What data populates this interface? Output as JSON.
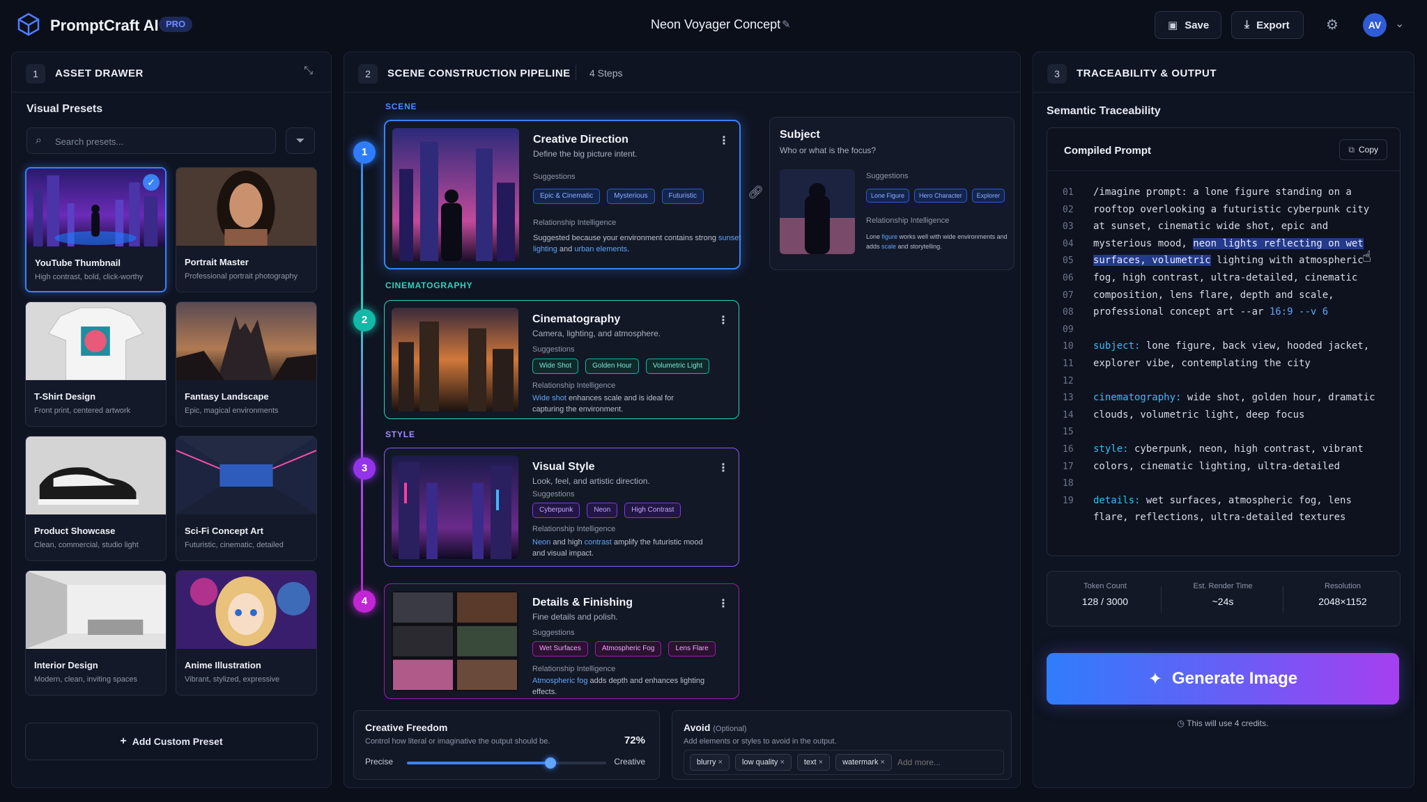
{
  "app": {
    "title": "PromptCraft AI",
    "badge": "PRO",
    "project_title": "Neon Voyager Concept"
  },
  "toolbar": {
    "save_label": "Save",
    "export_label": "Export",
    "avatar_initials": "AV"
  },
  "left": {
    "panel_num": "1",
    "panel_title": "ASSET DRAWER",
    "section_title": "Visual Presets",
    "search_placeholder": "Search presets...",
    "presets": [
      {
        "name": "YouTube Thumbnail",
        "desc": "High contrast, bold, click-worthy",
        "selected": true
      },
      {
        "name": "Portrait Master",
        "desc": "Professional portrait photography"
      },
      {
        "name": "T-Shirt Design",
        "desc": "Front print, centered artwork"
      },
      {
        "name": "Fantasy Landscape",
        "desc": "Epic, magical environments"
      },
      {
        "name": "Product Showcase",
        "desc": "Clean, commercial, studio light"
      },
      {
        "name": "Sci-Fi Concept Art",
        "desc": "Futuristic, cinematic, detailed"
      },
      {
        "name": "Interior Design",
        "desc": "Modern, clean, inviting spaces"
      },
      {
        "name": "Anime Illustration",
        "desc": "Vibrant, stylized, expressive"
      }
    ],
    "add_label": "Add Custom Preset"
  },
  "middle": {
    "panel_num": "2",
    "panel_title": "SCENE CONSTRUCTION PIPELINE",
    "steps_count": "4 Steps",
    "steps": [
      {
        "section": "SCENE",
        "num": "1",
        "title": "Creative Direction",
        "sub": "Define the big picture intent.",
        "sug_label": "Suggestions",
        "chips": [
          "Epic & Cinematic",
          "Mysterious",
          "Futuristic"
        ],
        "rel_label": "Relationship Intelligence",
        "rel_pre": "Suggested because your environment contains strong ",
        "rel_h1": "sunset lighting",
        "rel_mid": " and ",
        "rel_h2": "urban elements",
        "rel_post": "."
      },
      {
        "section": "CINEMATOGRAPHY",
        "num": "2",
        "title": "Cinematography",
        "sub": "Camera, lighting, and atmosphere.",
        "sug_label": "Suggestions",
        "chips": [
          "Wide Shot",
          "Golden Hour",
          "Volumetric Light"
        ],
        "rel_label": "Relationship Intelligence",
        "rel_h1": "Wide shot",
        "rel_post": " enhances scale and is ideal for capturing the environment."
      },
      {
        "section": "STYLE",
        "num": "3",
        "title": "Visual Style",
        "sub": "Look, feel, and artistic direction.",
        "sug_label": "Suggestions",
        "chips": [
          "Cyberpunk",
          "Neon",
          "High Contrast"
        ],
        "rel_label": "Relationship Intelligence",
        "rel_h1": "Neon",
        "rel_mid": " and high ",
        "rel_h2": "contrast",
        "rel_post": " amplify the futuristic mood and visual impact."
      },
      {
        "num": "4",
        "title": "Details & Finishing",
        "sub": "Fine details and polish.",
        "sug_label": "Suggestions",
        "chips": [
          "Wet Surfaces",
          "Atmospheric Fog",
          "Lens Flare"
        ],
        "rel_label": "Relationship Intelligence",
        "rel_h1": "Atmospheric fog",
        "rel_post": " adds depth and enhances lighting effects."
      }
    ],
    "subject": {
      "title": "Subject",
      "sub": "Who or what is the focus?",
      "sug_label": "Suggestions",
      "chips": [
        "Lone Figure",
        "Hero Character",
        "Explorer"
      ],
      "rel_label": "Relationship Intelligence",
      "rel_pre": "Lone ",
      "rel_h1": "figure",
      "rel_mid": " works well with wide environments and adds ",
      "rel_h2": "scale",
      "rel_post": " and storytelling."
    },
    "freedom": {
      "title": "Creative Freedom",
      "desc": "Control how literal or imaginative the output should be.",
      "value_label": "72%",
      "value": 0.72,
      "left_label": "Precise",
      "right_label": "Creative"
    },
    "avoid": {
      "title": "Avoid",
      "optional": "(Optional)",
      "desc": "Add elements or styles to avoid in the output.",
      "tags": [
        "blurry",
        "low quality",
        "text",
        "watermark"
      ],
      "placeholder": "Add more..."
    }
  },
  "right": {
    "panel_num": "3",
    "panel_title": "TRACEABILITY & OUTPUT",
    "section_title": "Semantic Traceability",
    "compiled_label": "Compiled Prompt",
    "copy_label": "Copy",
    "lines": [
      {
        "n": "01",
        "t": "/imagine prompt: a lone figure standing on a"
      },
      {
        "n": "02",
        "t": "rooftop overlooking a futuristic cyberpunk city"
      },
      {
        "n": "03",
        "t": "at sunset, cinematic wide shot, epic and"
      },
      {
        "n": "04",
        "t": "mysterious mood, ",
        "h": "neon lights reflecting on wet"
      },
      {
        "n": "05",
        "h": "surfaces, volumetric",
        "t2": " lighting with atmospheric"
      },
      {
        "n": "06",
        "t": "fog, high contrast, ultra-detailed, cinematic"
      },
      {
        "n": "07",
        "t": "composition, lens flare, depth and scale,"
      },
      {
        "n": "08",
        "t": "professional concept art --ar ",
        "r": "16:9 --v 6"
      },
      {
        "n": "09",
        "t": ""
      },
      {
        "n": "10",
        "k": "subject:",
        "t2": " lone figure, back view, hooded jacket,"
      },
      {
        "n": "11",
        "t": "explorer vibe, contemplating the city"
      },
      {
        "n": "12",
        "t": ""
      },
      {
        "n": "13",
        "k": "cinematography:",
        "t2": " wide shot, golden hour, dramatic"
      },
      {
        "n": "14",
        "t": "clouds, volumetric light, deep focus"
      },
      {
        "n": "15",
        "t": ""
      },
      {
        "n": "16",
        "k": "style:",
        "t2": " cyberpunk, neon, high contrast, vibrant"
      },
      {
        "n": "17",
        "t": "colors, cinematic lighting, ultra-detailed"
      },
      {
        "n": "18",
        "t": ""
      },
      {
        "n": "19",
        "k": "details:",
        "t2": " wet surfaces, atmospheric fog, lens"
      },
      {
        "n": "",
        "t": "flare, reflections, ultra-detailed textures"
      }
    ],
    "stats": [
      {
        "label": "Token Count",
        "value": "128 / 3000"
      },
      {
        "label": "Est. Render Time",
        "value": "~24s"
      },
      {
        "label": "Resolution",
        "value": "2048×1152"
      }
    ],
    "generate_label": "Generate Image",
    "credits_note": "This will use 4 credits."
  },
  "colors": {
    "accent_blue": "#3b82f6",
    "teal": "#2dd4bf",
    "purple": "#a855f7",
    "magenta": "#c026d3"
  }
}
